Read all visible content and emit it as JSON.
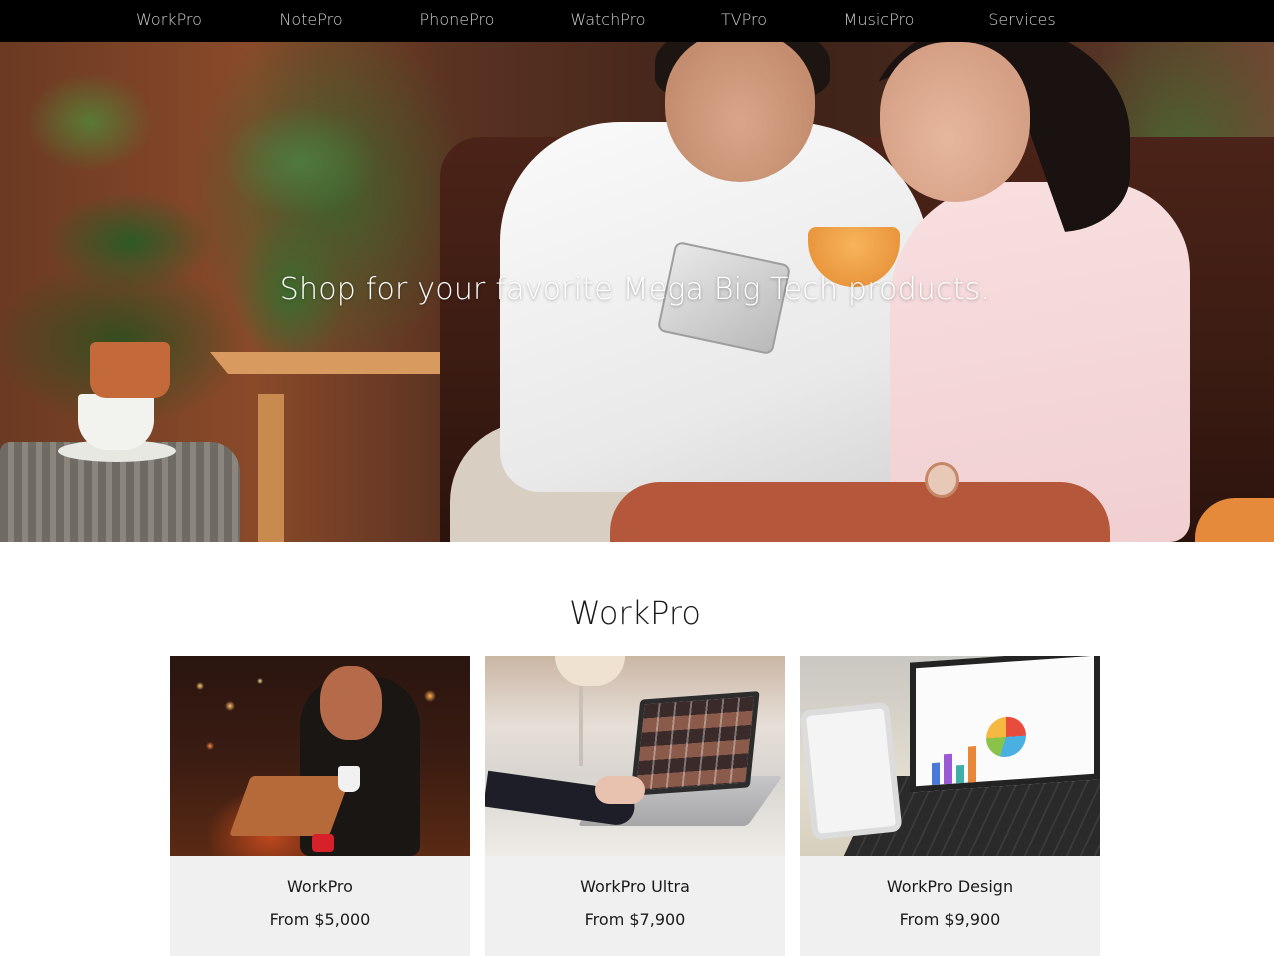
{
  "nav": {
    "items": [
      {
        "label": "WorkPro"
      },
      {
        "label": "NotePro"
      },
      {
        "label": "PhonePro"
      },
      {
        "label": "WatchPro"
      },
      {
        "label": "TVPro"
      },
      {
        "label": "MusicPro"
      },
      {
        "label": "Services"
      }
    ]
  },
  "hero": {
    "tagline": "Shop for your favorite Mega Big Tech products."
  },
  "section": {
    "title": "WorkPro",
    "products": [
      {
        "name": "WorkPro",
        "price": "From $5,000"
      },
      {
        "name": "WorkPro Ultra",
        "price": "From $7,900"
      },
      {
        "name": "WorkPro Design",
        "price": "From $9,900"
      }
    ]
  },
  "colors": {
    "nav_background": "#000000",
    "nav_text": "#d0d0d0",
    "card_background": "#f0f0f0",
    "hero_text": "#ffffff"
  }
}
